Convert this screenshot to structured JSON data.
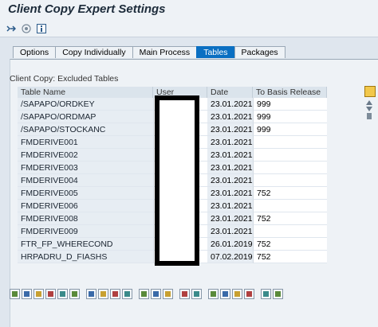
{
  "window": {
    "title": "Client Copy Expert Settings"
  },
  "toolbar": {
    "icons": [
      "expand-icon",
      "target-icon",
      "info-icon"
    ]
  },
  "tabs": [
    {
      "label": "Options",
      "active": false
    },
    {
      "label": "Copy Individually",
      "active": false
    },
    {
      "label": "Main Process",
      "active": false
    },
    {
      "label": "Tables",
      "active": true
    },
    {
      "label": "Packages",
      "active": false
    }
  ],
  "grid": {
    "title": "Client Copy: Excluded Tables",
    "headers": {
      "name": "Table Name",
      "user": "User",
      "date": "Date",
      "release": "To Basis Release"
    },
    "rows": [
      {
        "name": "/SAPAPO/ORDKEY",
        "date": "23.01.2021",
        "release": "999"
      },
      {
        "name": "/SAPAPO/ORDMAP",
        "date": "23.01.2021",
        "release": "999"
      },
      {
        "name": "/SAPAPO/STOCKANC",
        "date": "23.01.2021",
        "release": "999"
      },
      {
        "name": "FMDERIVE001",
        "date": "23.01.2021",
        "release": ""
      },
      {
        "name": "FMDERIVE002",
        "date": "23.01.2021",
        "release": ""
      },
      {
        "name": "FMDERIVE003",
        "date": "23.01.2021",
        "release": ""
      },
      {
        "name": "FMDERIVE004",
        "date": "23.01.2021",
        "release": ""
      },
      {
        "name": "FMDERIVE005",
        "date": "23.01.2021",
        "release": "752"
      },
      {
        "name": "FMDERIVE006",
        "date": "23.01.2021",
        "release": ""
      },
      {
        "name": "FMDERIVE008",
        "date": "23.01.2021",
        "release": "752"
      },
      {
        "name": "FMDERIVE009",
        "date": "23.01.2021",
        "release": ""
      },
      {
        "name": "FTR_FP_WHERECOND",
        "date": "26.01.2019",
        "release": "752"
      },
      {
        "name": "HRPADRU_D_FIASHS",
        "date": "07.02.2019",
        "release": "752"
      }
    ]
  },
  "bottom_toolbar": {
    "icons": [
      "details-icon",
      "insert-row-icon",
      "append-row-icon",
      "delete-row-icon",
      "copy-row-icon",
      "undo-icon",
      "insert-icon",
      "copy-icon",
      "paste-icon",
      "paste-append-icon",
      "cut-icon",
      "copy-text-icon",
      "paste-text-icon",
      "sort-ascending-icon",
      "sort-descending-icon",
      "find-icon",
      "find-next-icon",
      "filter-icon",
      "sum-icon",
      "undo-action-icon",
      "print-icon"
    ]
  },
  "colors": {
    "active_tab": "#0a6fc2",
    "background": "#dfe6ee"
  }
}
